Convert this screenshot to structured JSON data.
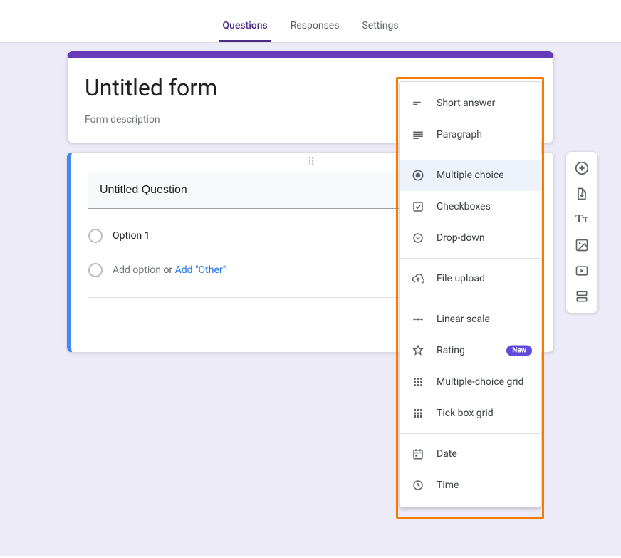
{
  "tabs": {
    "questions": "Questions",
    "responses": "Responses",
    "settings": "Settings"
  },
  "form": {
    "title": "Untitled form",
    "description": "Form description"
  },
  "question": {
    "title": "Untitled Question",
    "option1": "Option 1",
    "addOption": "Add option",
    "or": "or",
    "addOther": "Add \"Other\""
  },
  "menu": {
    "short_answer": "Short answer",
    "paragraph": "Paragraph",
    "multiple_choice": "Multiple choice",
    "checkboxes": "Checkboxes",
    "dropdown": "Drop-down",
    "file_upload": "File upload",
    "linear_scale": "Linear scale",
    "rating": "Rating",
    "rating_badge": "New",
    "multiple_choice_grid": "Multiple-choice grid",
    "tick_box_grid": "Tick box grid",
    "date": "Date",
    "time": "Time"
  }
}
